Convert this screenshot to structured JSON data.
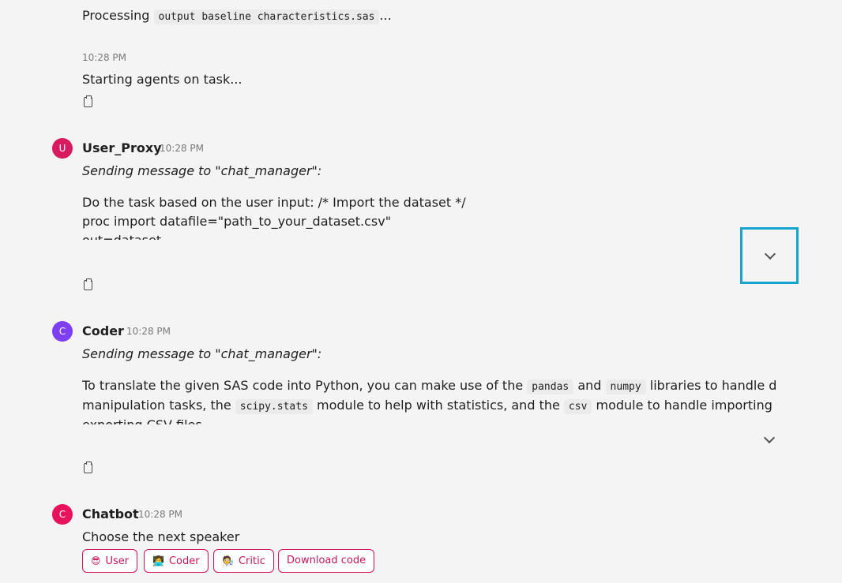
{
  "processing": {
    "prefix": "Processing",
    "file": "output baseline characteristics.sas",
    "suffix": "..."
  },
  "status_message": {
    "time": "10:28 PM",
    "text": "Starting agents on task..."
  },
  "messages": [
    {
      "author": "User_Proxy",
      "avatar_letter": "U",
      "avatar_color": "#d81b60",
      "time": "10:28 PM",
      "header": "Sending message to \"chat_manager\":",
      "line1": "Do the task based on the user input: /* Import the dataset */",
      "line2": "proc import datafile=\"path_to_your_dataset.csv\"",
      "line3": "out=dataset"
    },
    {
      "author": "Coder",
      "avatar_letter": "C",
      "avatar_color": "#7e3ff2",
      "time": "10:28 PM",
      "header": "Sending message to \"chat_manager\":",
      "l1_a": "To translate the given SAS code into Python, you can make use of the",
      "l1_code1": "pandas",
      "l1_b": "and",
      "l1_code2": "numpy",
      "l1_c": "libraries to handle data",
      "l2_a": "manipulation tasks, the",
      "l2_code1": "scipy.stats",
      "l2_b": "module to help with statistics, and the",
      "l2_code2": "csv",
      "l2_c": "module to handle importing and",
      "l3": "exporting CSV files."
    },
    {
      "author": "Chatbot",
      "avatar_letter": "C",
      "avatar_color": "#e8115b",
      "time": "10:28 PM",
      "text": "Choose the next speaker"
    }
  ],
  "speaker_buttons": [
    {
      "emoji": "😎",
      "label": "User"
    },
    {
      "emoji": "👩‍💻",
      "label": "Coder"
    },
    {
      "emoji": "🧑‍🔬",
      "label": "Critic"
    },
    {
      "emoji": "",
      "label": "Download code"
    }
  ],
  "colors": {
    "highlight_box": "#14a5cf",
    "button_border": "#d0135b"
  },
  "icons": [
    "copy-icon",
    "chevron-down-icon"
  ]
}
